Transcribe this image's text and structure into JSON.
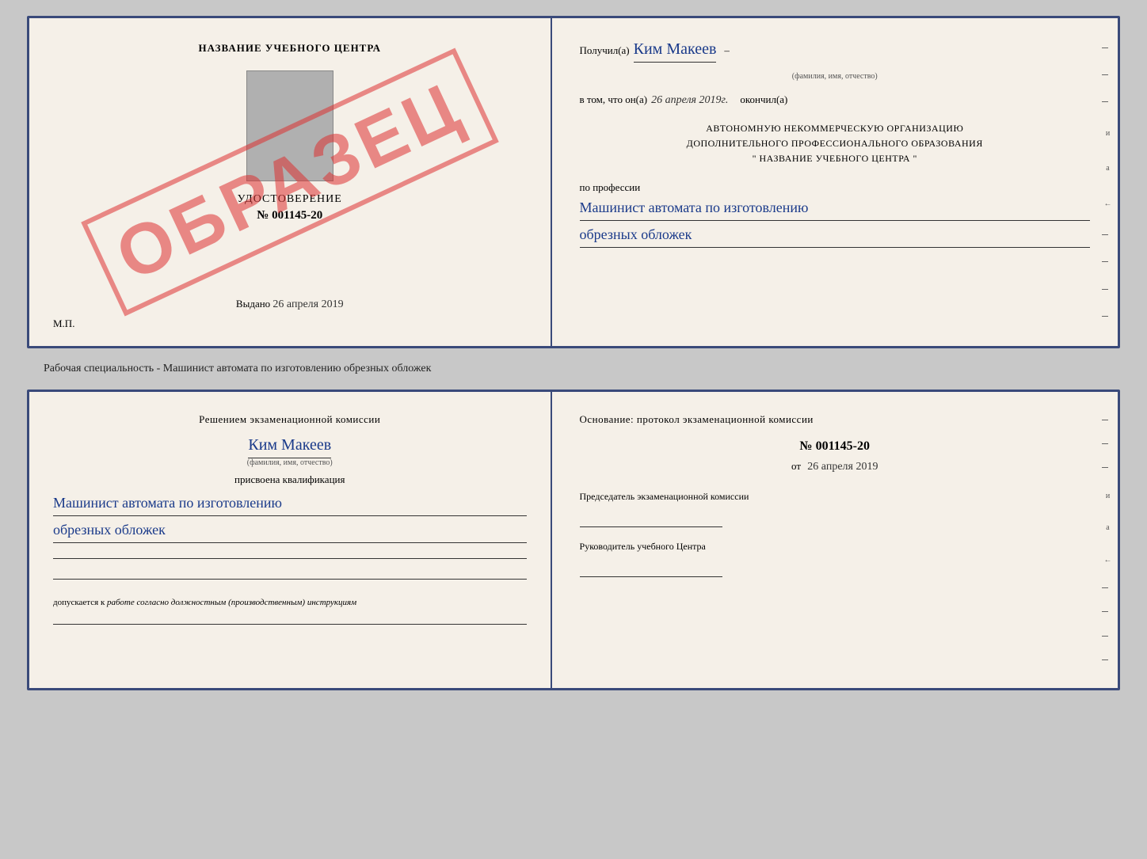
{
  "top_doc": {
    "left": {
      "center_name": "НАЗВАНИЕ УЧЕБНОГО ЦЕНТРА",
      "obrazec": "ОБРАЗЕЦ",
      "udostoverenie": "УДОСТОВЕРЕНИЕ",
      "number": "№ 001145-20",
      "vydano_label": "Выдано",
      "vydano_date": "26 апреля 2019",
      "mp": "М.П."
    },
    "right": {
      "poluchil_label": "Получил(а)",
      "poluchil_name": "Ким Макеев",
      "fio_sub": "(фамилия, имя, отчество)",
      "vtom_label": "в том, что он(а)",
      "vtom_date": "26 апреля 2019г.",
      "okonchil_label": "окончил(а)",
      "org_line1": "АВТОНОМНУЮ НЕКОММЕРЧЕСКУЮ ОРГАНИЗАЦИЮ",
      "org_line2": "ДОПОЛНИТЕЛЬНОГО ПРОФЕССИОНАЛЬНОГО ОБРАЗОВАНИЯ",
      "org_line3": "\"   НАЗВАНИЕ УЧЕБНОГО ЦЕНТРА   \"",
      "profession_label": "по профессии",
      "profession_line1": "Машинист автомата по изготовлению",
      "profession_line2": "обрезных обложек"
    }
  },
  "between_text": "Рабочая специальность - Машинист автомата по изготовлению обрезных обложек",
  "bottom_doc": {
    "left": {
      "komissia_text": "Решением экзаменационной комиссии",
      "name": "Ким Макеев",
      "fio_sub": "(фамилия, имя, отчество)",
      "prisvoena": "присвоена квалификация",
      "kvali_line1": "Машинист автомата по изготовлению",
      "kvali_line2": "обрезных обложек",
      "dopusk_label": "допускается к",
      "dopusk_text": "работе согласно должностным (производственным) инструкциям"
    },
    "right": {
      "osnov_label": "Основание: протокол экзаменационной комиссии",
      "protokol_number": "№  001145-20",
      "ot_label": "от",
      "protokol_date": "26 апреля 2019",
      "predsedatel_label": "Председатель экзаменационной комиссии",
      "rukovoditel_label": "Руководитель учебного Центра"
    }
  },
  "side_indicators": [
    "-",
    "-",
    "-",
    "и",
    "а",
    "←",
    "-",
    "-",
    "-",
    "-"
  ]
}
